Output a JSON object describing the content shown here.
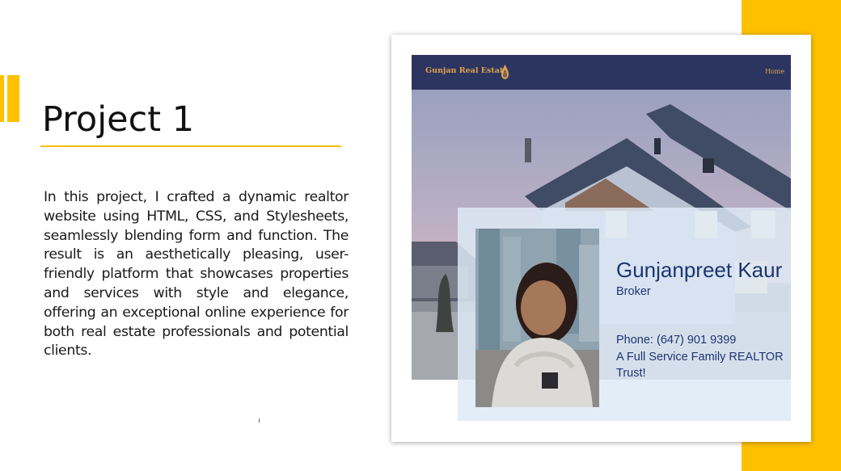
{
  "slide": {
    "title": "Project 1",
    "description": "In this project, I crafted a dynamic realtor website using HTML, CSS, and Stylesheets, seamlessly blending form and function. The result is an aesthetically pleasing, user-friendly platform that showcases properties and services with style and elegance, offering an exceptional online experience for both real estate professionals and potential clients."
  },
  "colors": {
    "accent": "#FFC000",
    "nav_background": "#2c3560",
    "nav_text": "#e0a24d",
    "card_text": "#1d3572"
  },
  "website": {
    "logo_text": "Gunjan Real Estate",
    "logo_icon": "flame-drop-icon",
    "nav": {
      "home_label": "Home"
    },
    "agent": {
      "name": "Gunjanpreet Kaur",
      "role": "Broker",
      "phone": "Phone: (647) 901 9399",
      "tagline": "A Full Service Family REALTOR Trust!"
    }
  }
}
